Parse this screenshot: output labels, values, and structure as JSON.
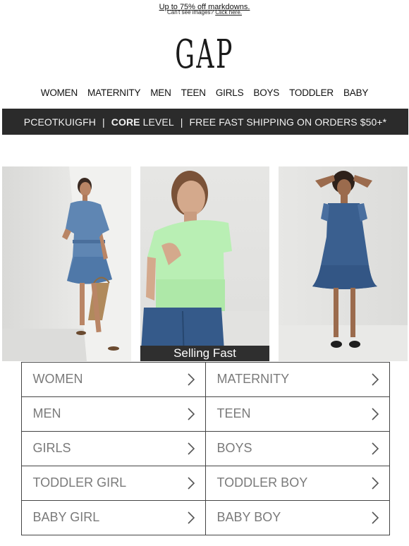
{
  "preheader": {
    "promo_link": "Up to 75% off markdowns.",
    "cant_see_text": "Can't see images?",
    "click_here": "Click here."
  },
  "logo": {
    "text": "GAP"
  },
  "topnav": {
    "items": [
      "WOMEN",
      "MATERNITY",
      "MEN",
      "TEEN",
      "GIRLS",
      "BOYS",
      "TODDLER",
      "BABY"
    ]
  },
  "banner": {
    "customer_id": "PCEOTKUIGFH",
    "separator": "|",
    "level_bold": "CORE",
    "level_suffix": "LEVEL",
    "shipping": "FREE FAST SHIPPING ON ORDERS $50+*"
  },
  "photos": {
    "badge": "Selling Fast"
  },
  "category_grid": {
    "items": [
      {
        "label": "WOMEN"
      },
      {
        "label": "MATERNITY"
      },
      {
        "label": "MEN"
      },
      {
        "label": "TEEN"
      },
      {
        "label": "GIRLS"
      },
      {
        "label": "BOYS"
      },
      {
        "label": "TODDLER GIRL"
      },
      {
        "label": "TODDLER BOY"
      },
      {
        "label": "BABY GIRL"
      },
      {
        "label": "BABY BOY"
      }
    ],
    "icon": "chevron-right-icon"
  },
  "colors": {
    "banner_bg": "#2b2b2b",
    "grid_text": "#7a7a7a",
    "grid_border": "#444444"
  }
}
